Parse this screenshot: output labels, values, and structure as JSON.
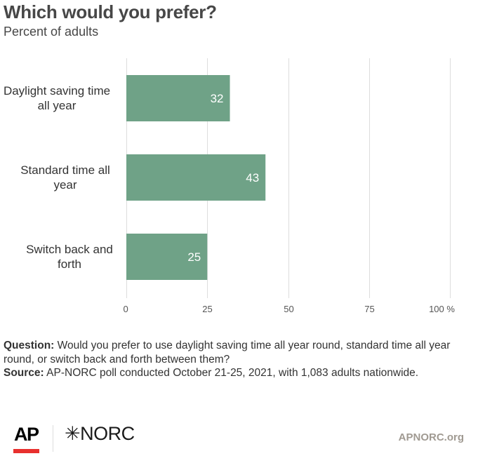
{
  "header": {
    "title": "Which would you prefer?",
    "subtitle": "Percent of adults"
  },
  "chart_data": {
    "type": "bar",
    "orientation": "horizontal",
    "title": "Which would you prefer?",
    "subtitle": "Percent of adults",
    "categories": [
      [
        "Daylight saving time",
        "all year"
      ],
      [
        "Standard time all",
        "year"
      ],
      [
        "Switch back and",
        "forth"
      ]
    ],
    "values": [
      32,
      43,
      25
    ],
    "xlim": [
      0,
      100
    ],
    "xticks": [
      0,
      25,
      50,
      75,
      100
    ],
    "xtick_labels": [
      "0",
      "25",
      "50",
      "75",
      "100 %"
    ],
    "grid": true,
    "bar_color": "#6fa287",
    "label_color": "#ffffff",
    "xlabel": "",
    "ylabel": ""
  },
  "notes": {
    "question_label": "Question:",
    "question_text": " Would you prefer to use daylight saving time all year round, standard time all year round, or switch back and forth between them?",
    "source_label": "Source:",
    "source_text": " AP-NORC poll conducted October 21-25, 2021, with 1,083 adults nationwide."
  },
  "footer": {
    "ap_logo": "AP",
    "norc_logo": "✳NORC",
    "norc_star": "✳",
    "norc_text": "NORC",
    "url": "APNORC.org"
  }
}
